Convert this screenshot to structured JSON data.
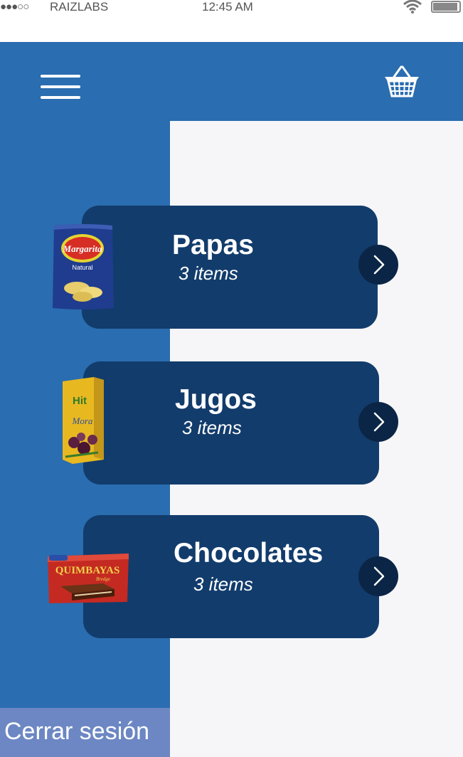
{
  "status_bar": {
    "signal": "●●●○○",
    "carrier": "RAIZLABS",
    "time": "12:45 AM"
  },
  "header": {
    "menu_icon": "hamburger-menu-icon",
    "cart_icon": "shopping-basket-icon"
  },
  "colors": {
    "primary": "#2a6db0",
    "card": "#123c6c",
    "arrow_bg": "#0b2546",
    "logout_bg": "#6c87c3"
  },
  "categories": [
    {
      "title": "Papas",
      "count": "3 items",
      "brand": "Margarita",
      "subtitle": "Natural"
    },
    {
      "title": "Jugos",
      "count": "3 items",
      "brand": "Hit",
      "subtitle": "Mora"
    },
    {
      "title": "Chocolates",
      "count": "3 items",
      "brand": "QUIMBAYAS",
      "subtitle": "Bredge"
    }
  ],
  "sidebar": {
    "logout_label": "Cerrar sesión"
  }
}
